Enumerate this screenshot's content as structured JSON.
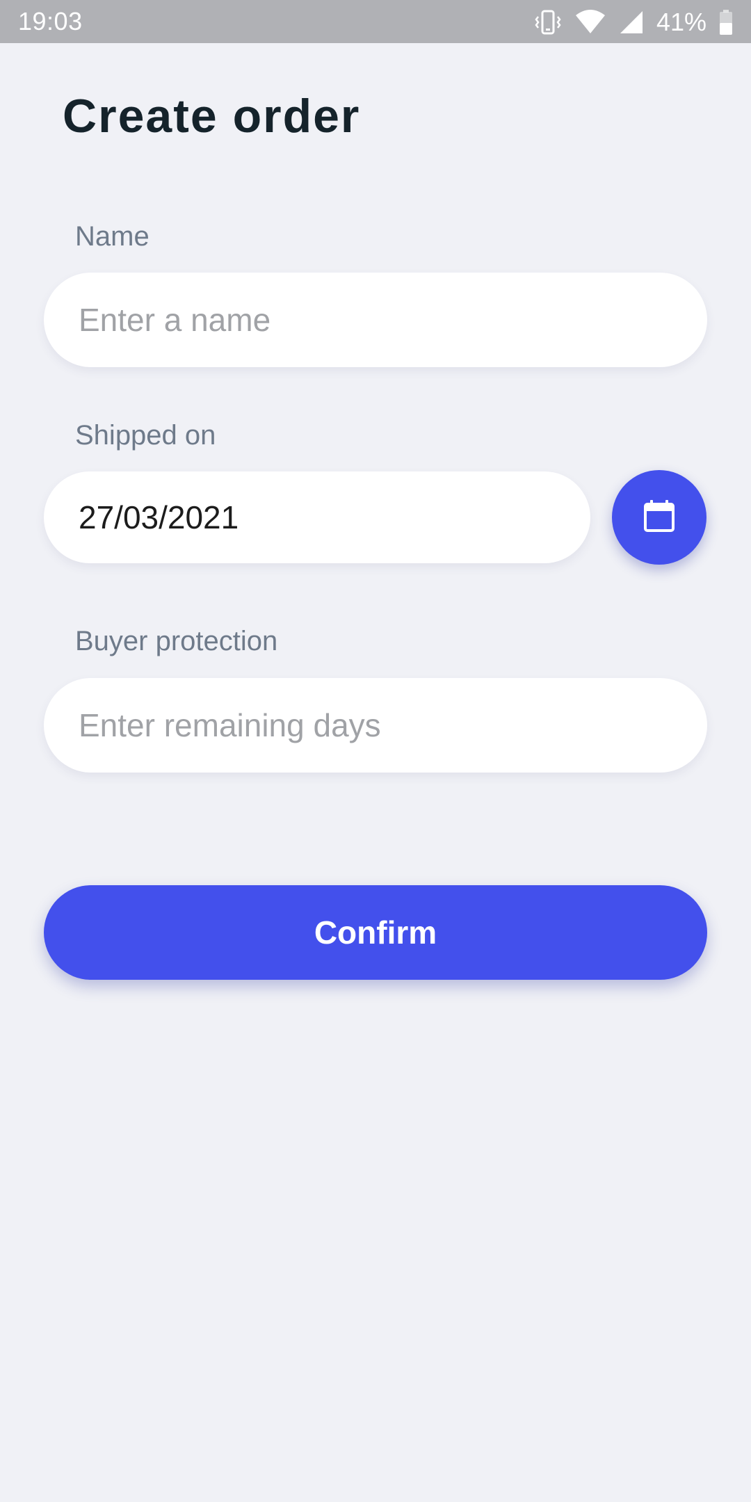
{
  "status_bar": {
    "time": "19:03",
    "battery": "41%",
    "icons": [
      "vibrate-icon",
      "wifi-icon",
      "signal-icon",
      "battery-icon"
    ]
  },
  "page": {
    "title": "Create order"
  },
  "form": {
    "name": {
      "label": "Name",
      "placeholder": "Enter a name",
      "value": ""
    },
    "shipped_on": {
      "label": "Shipped on",
      "value": "27/03/2021",
      "picker_icon": "calendar-icon"
    },
    "buyer_protection": {
      "label": "Buyer protection",
      "placeholder": "Enter remaining days",
      "value": ""
    }
  },
  "actions": {
    "confirm_label": "Confirm"
  },
  "colors": {
    "accent": "#4350ec",
    "background": "#f0f1f6",
    "status_bar": "#b0b1b5",
    "label": "#6e7a8a",
    "title": "#15232b"
  }
}
